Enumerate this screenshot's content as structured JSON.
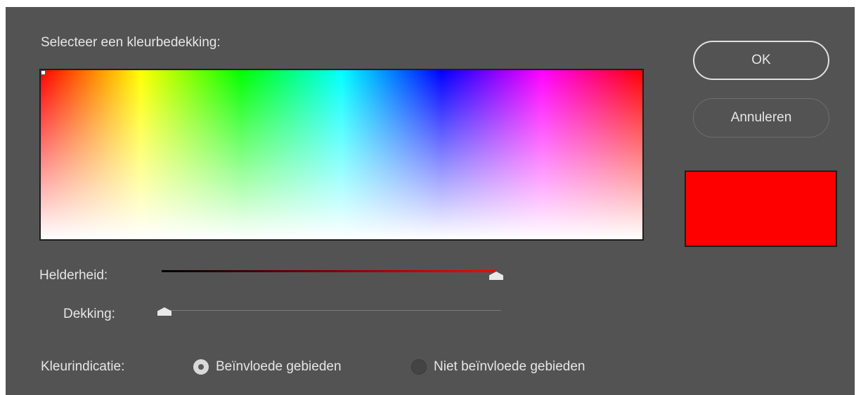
{
  "dialog": {
    "heading": "Selecteer een kleurbedekking:",
    "ok_label": "OK",
    "cancel_label": "Annuleren",
    "selected_color": "#ff0000"
  },
  "sliders": {
    "brightness": {
      "label": "Helderheid:",
      "value": 1.0,
      "gradient_end_color": "#ff0000"
    },
    "opacity": {
      "label": "Dekking:",
      "value": 0.0
    }
  },
  "indicator": {
    "label": "Kleurindicatie:",
    "options": [
      {
        "label": "Beïnvloede gebieden",
        "checked": true
      },
      {
        "label": "Niet beïnvloede gebieden",
        "checked": false
      }
    ]
  }
}
